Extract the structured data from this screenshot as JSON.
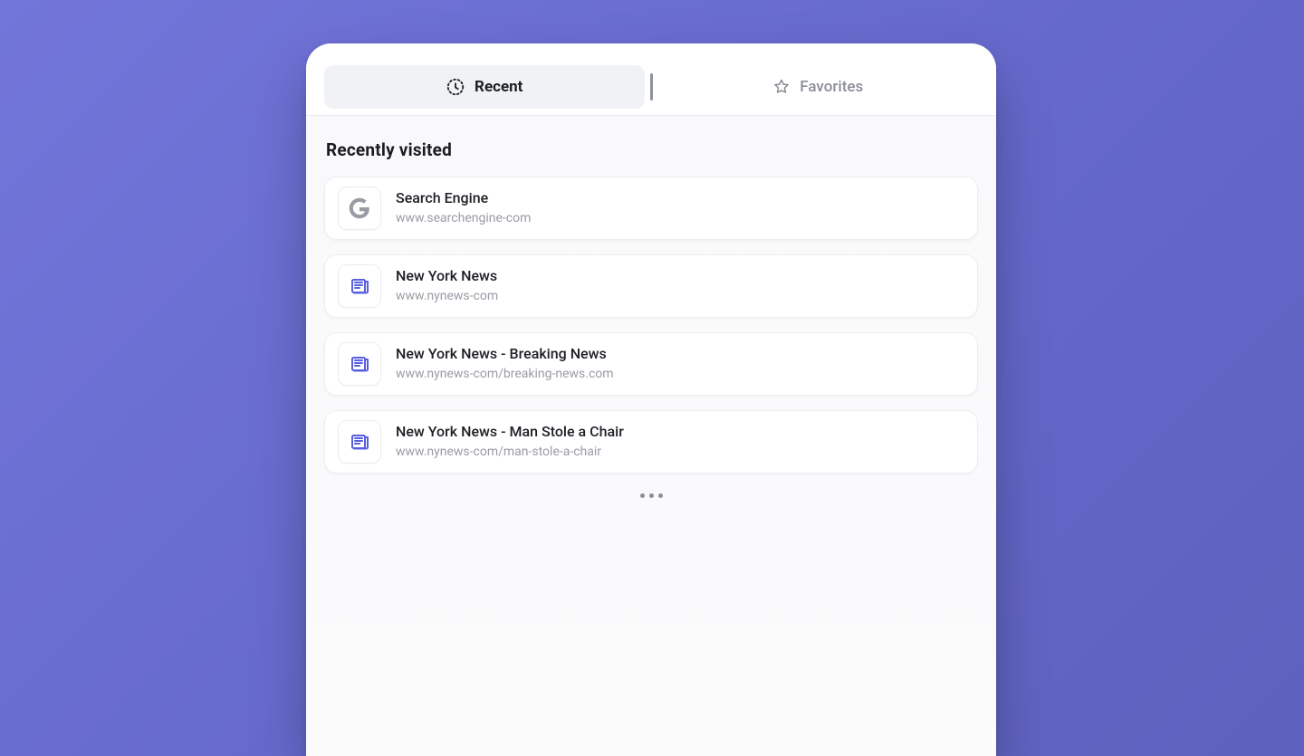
{
  "tabs": {
    "recent": "Recent",
    "favorites": "Favorites"
  },
  "section_title": "Recently visited",
  "items": [
    {
      "title": "Search Engine",
      "url": "www.searchengine-com",
      "icon": "google"
    },
    {
      "title": "New York News",
      "url": "www.nynews-com",
      "icon": "news"
    },
    {
      "title": "New York News - Breaking News",
      "url": "www.nynews-com/breaking-news.com",
      "icon": "news"
    },
    {
      "title": "New York News - Man Stole a Chair",
      "url": "www.nynews-com/man-stole-a-chair",
      "icon": "news"
    }
  ]
}
